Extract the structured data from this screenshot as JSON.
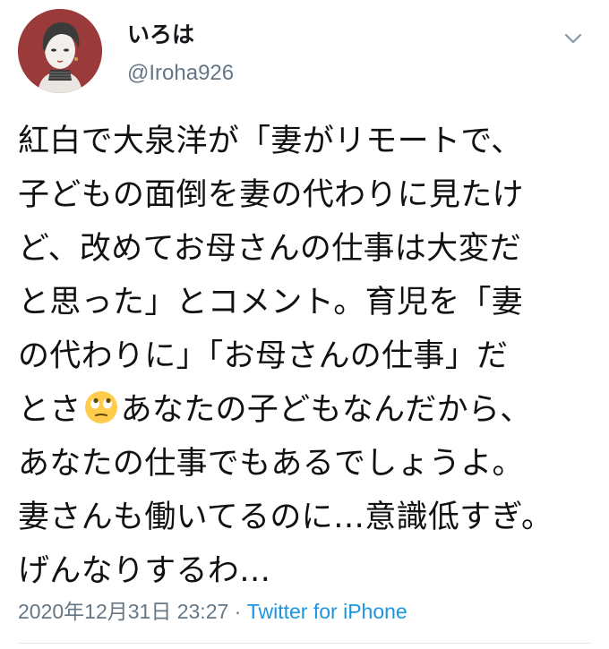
{
  "tweet": {
    "author": {
      "display_name": "いろは",
      "handle": "@Iroha926",
      "avatar_icon": "portrait-avatar"
    },
    "menu_icon": "chevron-down-icon",
    "text_lines": {
      "l1": "紅白で大泉洋が「妻がリモートで、",
      "l2": "子どもの面倒を妻の代わりに見たけ",
      "l3": "ど、改めてお母さんの仕事は大変だ",
      "l4": "と思った」とコメント。育児を「妻",
      "l5": "の代わりに」「お母さんの仕事」だ",
      "l6_before_emoji": "とさ",
      "l6_after_emoji": "あなたの子どもなんだから、",
      "l7": "あなたの仕事でもあるでしょうよ。",
      "l8": "妻さんも働いてるのに…意識低すぎ。",
      "l9": "げんなりするわ…"
    },
    "emoji": "face-with-rolling-eyes",
    "timestamp": "2020年12月31日 23:27",
    "separator": " · ",
    "source": "Twitter for iPhone",
    "colors": {
      "text": "#14171a",
      "secondary": "#657786",
      "link": "#1b95e0",
      "avatar_bg": "#9b3a3a"
    }
  }
}
